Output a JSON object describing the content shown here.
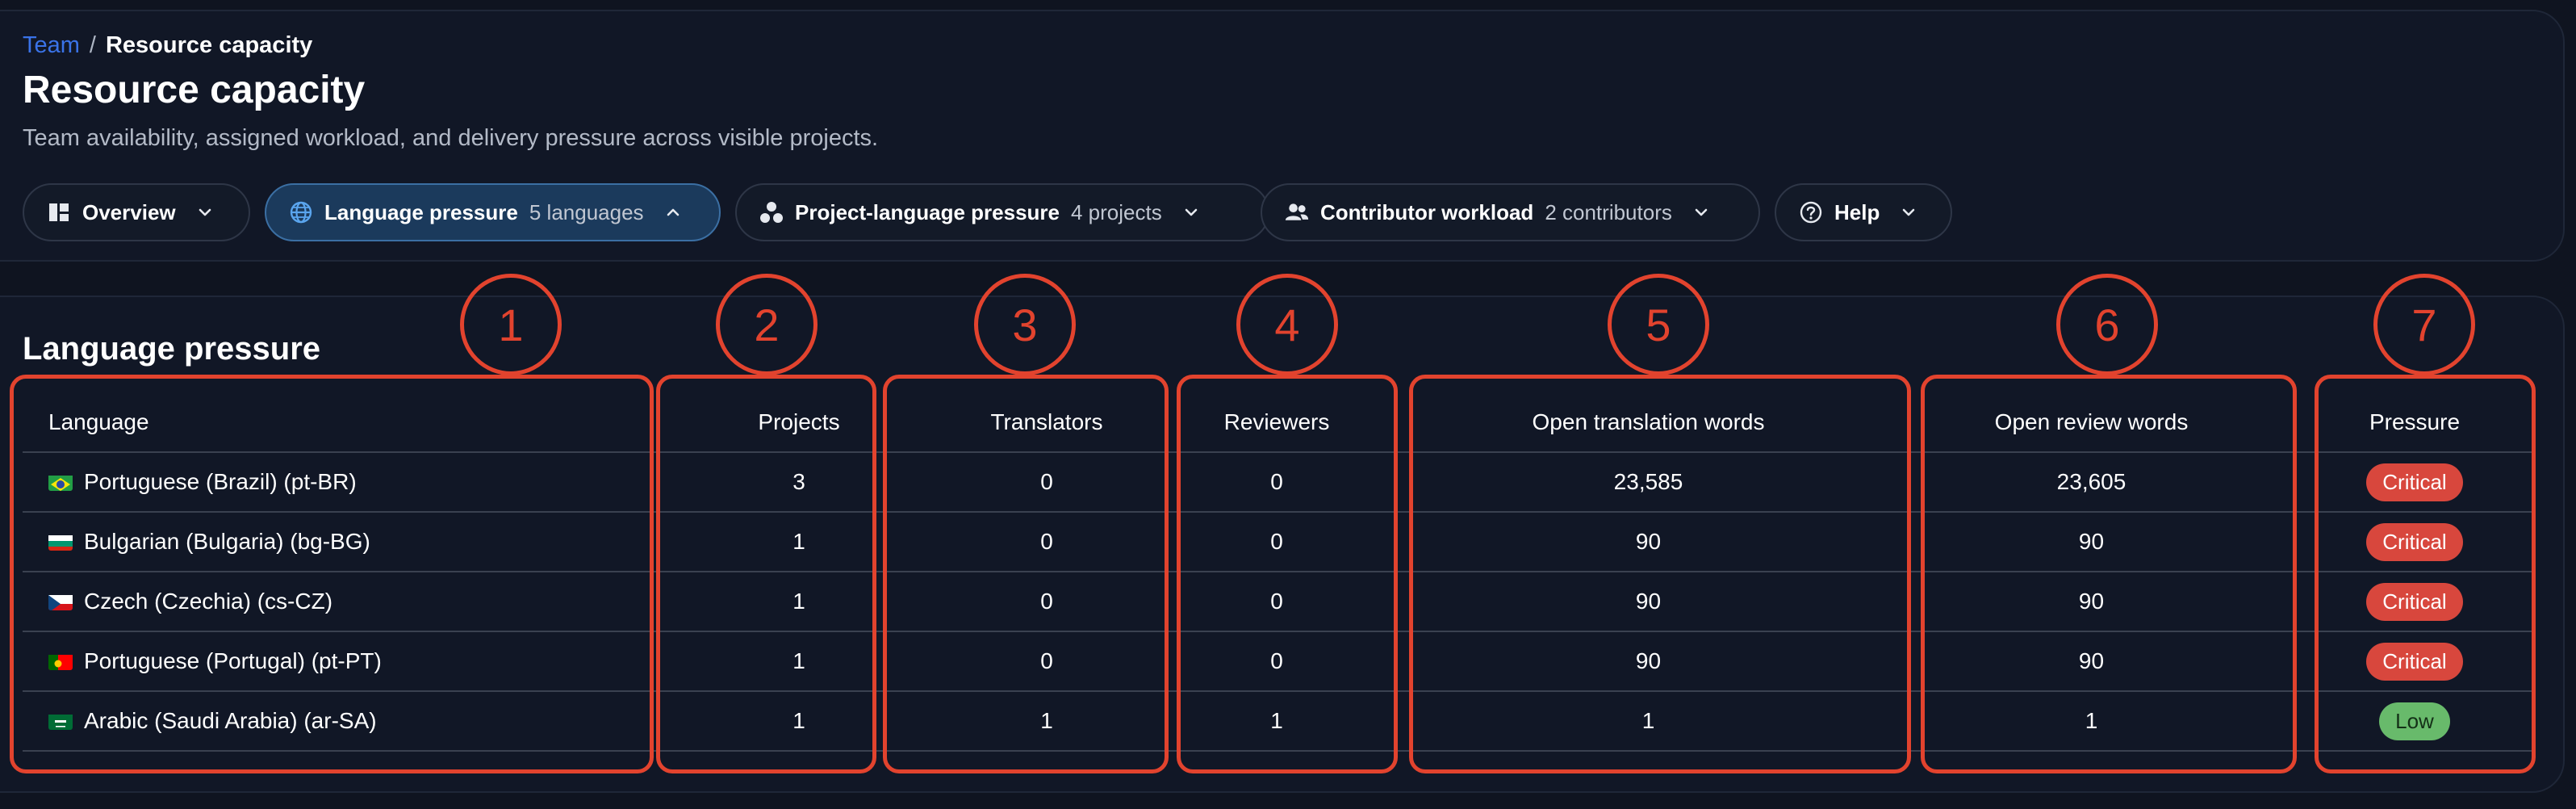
{
  "breadcrumb": {
    "parent": "Team",
    "separator": "/",
    "current": "Resource capacity"
  },
  "page": {
    "title": "Resource capacity",
    "subtitle": "Team availability, assigned workload, and delivery pressure across visible projects."
  },
  "tabs": [
    {
      "label": "Overview",
      "count": "",
      "icon": "dashboard-icon",
      "active": false
    },
    {
      "label": "Language pressure",
      "count": "5 languages",
      "icon": "globe-icon",
      "active": true
    },
    {
      "label": "Project-language pressure",
      "count": "4 projects",
      "icon": "project-dots-icon",
      "active": false
    },
    {
      "label": "Contributor workload",
      "count": "2 contributors",
      "icon": "people-icon",
      "active": false
    },
    {
      "label": "Help",
      "count": "",
      "icon": "help-circle-icon",
      "active": false
    }
  ],
  "section": {
    "title": "Language pressure"
  },
  "table": {
    "columns": [
      "Language",
      "Projects",
      "Translators",
      "Reviewers",
      "Open translation words",
      "Open review words",
      "Pressure"
    ],
    "rows": [
      {
        "flag": "brazil-flag-icon",
        "language": "Portuguese (Brazil) (pt-BR)",
        "projects": "3",
        "translators": "0",
        "reviewers": "0",
        "open_translation": "23,585",
        "open_review": "23,605",
        "pressure": "Critical"
      },
      {
        "flag": "bulgaria-flag-icon",
        "language": "Bulgarian (Bulgaria) (bg-BG)",
        "projects": "1",
        "translators": "0",
        "reviewers": "0",
        "open_translation": "90",
        "open_review": "90",
        "pressure": "Critical"
      },
      {
        "flag": "czechia-flag-icon",
        "language": "Czech (Czechia) (cs-CZ)",
        "projects": "1",
        "translators": "0",
        "reviewers": "0",
        "open_translation": "90",
        "open_review": "90",
        "pressure": "Critical"
      },
      {
        "flag": "portugal-flag-icon",
        "language": "Portuguese (Portugal) (pt-PT)",
        "projects": "1",
        "translators": "0",
        "reviewers": "0",
        "open_translation": "90",
        "open_review": "90",
        "pressure": "Critical"
      },
      {
        "flag": "saudi-arabia-flag-icon",
        "language": "Arabic (Saudi Arabia) (ar-SA)",
        "projects": "1",
        "translators": "1",
        "reviewers": "1",
        "open_translation": "1",
        "open_review": "1",
        "pressure": "Low"
      }
    ]
  },
  "annotations": [
    "1",
    "2",
    "3",
    "4",
    "5",
    "6",
    "7"
  ],
  "colors": {
    "critical": "#d8473d",
    "low": "#68ba6b",
    "annotation": "#e2432e",
    "link": "#3a73e8",
    "active_tab": "#1b3a5c"
  }
}
